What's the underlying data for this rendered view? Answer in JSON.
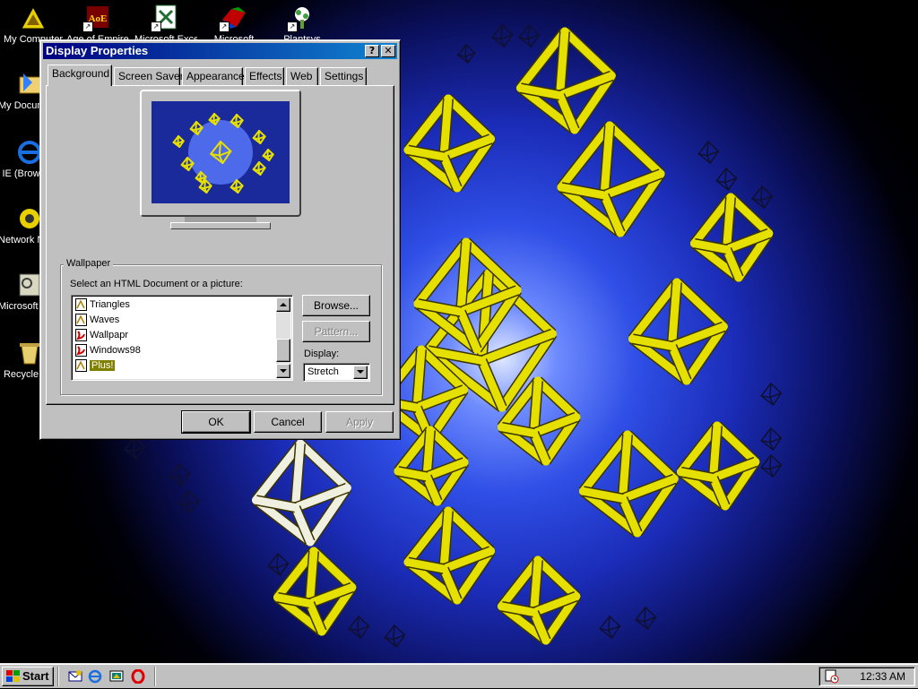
{
  "desktop": {
    "icons": [
      {
        "label": "My Computer",
        "glyph": "my-computer-icon"
      },
      {
        "label": "Age of Empires",
        "glyph": "age-of-empires-icon"
      },
      {
        "label": "Microsoft Excel",
        "glyph": "excel-icon"
      },
      {
        "label": "Microsoft",
        "glyph": "microsoft-icon"
      },
      {
        "label": "Plantsvs",
        "glyph": "plant-icon"
      },
      {
        "label": "My Documents",
        "glyph": "my-documents-icon"
      },
      {
        "label": "IE (Browser)",
        "glyph": "internet-explorer-icon"
      },
      {
        "label": "Network Neighborhood",
        "glyph": "network-icon"
      },
      {
        "label": "Microsoft Outlook",
        "glyph": "outlook-icon"
      },
      {
        "label": "Recycle Bin",
        "glyph": "recycle-bin-icon"
      }
    ]
  },
  "dialog": {
    "title": "Display Properties",
    "help_glyph": "?",
    "close_glyph": "✕",
    "tabs": [
      "Background",
      "Screen Saver",
      "Appearance",
      "Effects",
      "Web",
      "Settings"
    ],
    "active_tab": "Background",
    "wallpaper_group": "Wallpaper",
    "select_label": "Select an HTML Document or a picture:",
    "wallpapers": [
      {
        "name": "Triangles",
        "icon": "bitmap-file-icon"
      },
      {
        "name": "Waves",
        "icon": "bitmap-file-icon"
      },
      {
        "name": "Wallpapr",
        "icon": "html-file-icon"
      },
      {
        "name": "Windows98",
        "icon": "html-file-icon"
      },
      {
        "name": "Plus!",
        "icon": "bitmap-file-icon",
        "selected": true
      }
    ],
    "browse_label": "Browse...",
    "pattern_label": "Pattern...",
    "display_label": "Display:",
    "display_value": "Stretch",
    "ok_label": "OK",
    "cancel_label": "Cancel",
    "apply_label": "Apply"
  },
  "taskbar": {
    "start_label": "Start",
    "quick_launch": [
      "outlook-express-icon",
      "internet-explorer-icon",
      "show-desktop-icon",
      "opera-icon"
    ],
    "clock": "12:33 AM"
  },
  "colors": {
    "title_bar": "#000080",
    "selection": "#808000",
    "desktop_blue": "#2f4fe6",
    "frame_yellow": "#e6e000"
  }
}
